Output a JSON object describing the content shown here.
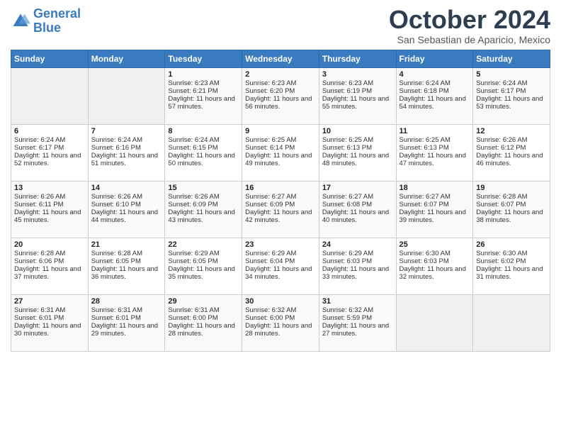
{
  "header": {
    "logo_line1": "General",
    "logo_line2": "Blue",
    "month": "October 2024",
    "location": "San Sebastian de Aparicio, Mexico"
  },
  "weekdays": [
    "Sunday",
    "Monday",
    "Tuesday",
    "Wednesday",
    "Thursday",
    "Friday",
    "Saturday"
  ],
  "weeks": [
    [
      {
        "day": "",
        "empty": true
      },
      {
        "day": "",
        "empty": true
      },
      {
        "day": "1",
        "sunrise": "6:23 AM",
        "sunset": "6:21 PM",
        "daylight": "11 hours and 57 minutes."
      },
      {
        "day": "2",
        "sunrise": "6:23 AM",
        "sunset": "6:20 PM",
        "daylight": "11 hours and 56 minutes."
      },
      {
        "day": "3",
        "sunrise": "6:23 AM",
        "sunset": "6:19 PM",
        "daylight": "11 hours and 55 minutes."
      },
      {
        "day": "4",
        "sunrise": "6:24 AM",
        "sunset": "6:18 PM",
        "daylight": "11 hours and 54 minutes."
      },
      {
        "day": "5",
        "sunrise": "6:24 AM",
        "sunset": "6:17 PM",
        "daylight": "11 hours and 53 minutes."
      }
    ],
    [
      {
        "day": "6",
        "sunrise": "6:24 AM",
        "sunset": "6:17 PM",
        "daylight": "11 hours and 52 minutes."
      },
      {
        "day": "7",
        "sunrise": "6:24 AM",
        "sunset": "6:16 PM",
        "daylight": "11 hours and 51 minutes."
      },
      {
        "day": "8",
        "sunrise": "6:24 AM",
        "sunset": "6:15 PM",
        "daylight": "11 hours and 50 minutes."
      },
      {
        "day": "9",
        "sunrise": "6:25 AM",
        "sunset": "6:14 PM",
        "daylight": "11 hours and 49 minutes."
      },
      {
        "day": "10",
        "sunrise": "6:25 AM",
        "sunset": "6:13 PM",
        "daylight": "11 hours and 48 minutes."
      },
      {
        "day": "11",
        "sunrise": "6:25 AM",
        "sunset": "6:13 PM",
        "daylight": "11 hours and 47 minutes."
      },
      {
        "day": "12",
        "sunrise": "6:26 AM",
        "sunset": "6:12 PM",
        "daylight": "11 hours and 46 minutes."
      }
    ],
    [
      {
        "day": "13",
        "sunrise": "6:26 AM",
        "sunset": "6:11 PM",
        "daylight": "11 hours and 45 minutes."
      },
      {
        "day": "14",
        "sunrise": "6:26 AM",
        "sunset": "6:10 PM",
        "daylight": "11 hours and 44 minutes."
      },
      {
        "day": "15",
        "sunrise": "6:26 AM",
        "sunset": "6:09 PM",
        "daylight": "11 hours and 43 minutes."
      },
      {
        "day": "16",
        "sunrise": "6:27 AM",
        "sunset": "6:09 PM",
        "daylight": "11 hours and 42 minutes."
      },
      {
        "day": "17",
        "sunrise": "6:27 AM",
        "sunset": "6:08 PM",
        "daylight": "11 hours and 40 minutes."
      },
      {
        "day": "18",
        "sunrise": "6:27 AM",
        "sunset": "6:07 PM",
        "daylight": "11 hours and 39 minutes."
      },
      {
        "day": "19",
        "sunrise": "6:28 AM",
        "sunset": "6:07 PM",
        "daylight": "11 hours and 38 minutes."
      }
    ],
    [
      {
        "day": "20",
        "sunrise": "6:28 AM",
        "sunset": "6:06 PM",
        "daylight": "11 hours and 37 minutes."
      },
      {
        "day": "21",
        "sunrise": "6:28 AM",
        "sunset": "6:05 PM",
        "daylight": "11 hours and 36 minutes."
      },
      {
        "day": "22",
        "sunrise": "6:29 AM",
        "sunset": "6:05 PM",
        "daylight": "11 hours and 35 minutes."
      },
      {
        "day": "23",
        "sunrise": "6:29 AM",
        "sunset": "6:04 PM",
        "daylight": "11 hours and 34 minutes."
      },
      {
        "day": "24",
        "sunrise": "6:29 AM",
        "sunset": "6:03 PM",
        "daylight": "11 hours and 33 minutes."
      },
      {
        "day": "25",
        "sunrise": "6:30 AM",
        "sunset": "6:03 PM",
        "daylight": "11 hours and 32 minutes."
      },
      {
        "day": "26",
        "sunrise": "6:30 AM",
        "sunset": "6:02 PM",
        "daylight": "11 hours and 31 minutes."
      }
    ],
    [
      {
        "day": "27",
        "sunrise": "6:31 AM",
        "sunset": "6:01 PM",
        "daylight": "11 hours and 30 minutes."
      },
      {
        "day": "28",
        "sunrise": "6:31 AM",
        "sunset": "6:01 PM",
        "daylight": "11 hours and 29 minutes."
      },
      {
        "day": "29",
        "sunrise": "6:31 AM",
        "sunset": "6:00 PM",
        "daylight": "11 hours and 28 minutes."
      },
      {
        "day": "30",
        "sunrise": "6:32 AM",
        "sunset": "6:00 PM",
        "daylight": "11 hours and 28 minutes."
      },
      {
        "day": "31",
        "sunrise": "6:32 AM",
        "sunset": "5:59 PM",
        "daylight": "11 hours and 27 minutes."
      },
      {
        "day": "",
        "empty": true
      },
      {
        "day": "",
        "empty": true
      }
    ]
  ],
  "labels": {
    "sunrise": "Sunrise: ",
    "sunset": "Sunset: ",
    "daylight": "Daylight: "
  }
}
